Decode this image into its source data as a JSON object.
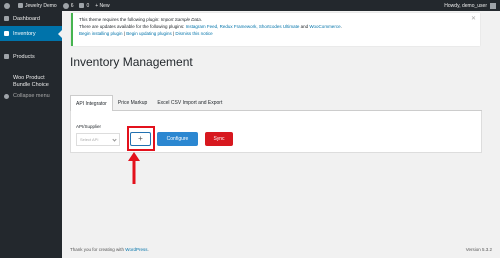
{
  "adminbar": {
    "site_name": "Jewelry Demo",
    "updates_count": "6",
    "comments_count": "0",
    "new_label": "+ New",
    "greeting": "Howdy, demo_user"
  },
  "sidebar": {
    "items": [
      {
        "label": "Dashboard"
      },
      {
        "label": "Inventory"
      },
      {
        "label": "Products"
      },
      {
        "label_line1": "Woo Product",
        "label_line2": "Bundle Choice"
      },
      {
        "label": "Collapse menu"
      }
    ]
  },
  "notice": {
    "line1_prefix": "This theme requires the following plugin: ",
    "line1_plugin": "Import Sample Data",
    "line1_suffix": ".",
    "line2_prefix": "There are updates available for the following plugins: ",
    "line2_plugins": "Instagram Feed, Redux Framework, Shortcodes Ultimate",
    "line2_and": " and ",
    "line2_last": "WooCommerce",
    "line2_suffix": ".",
    "action_begin_installing": "Begin installing plugin",
    "action_begin_updating": "Begin updating plugins",
    "action_dismiss": "Dismiss this notice",
    "separator": " | ",
    "dismiss_glyph": "✕"
  },
  "page": {
    "title": "Inventory Management"
  },
  "tabs": [
    {
      "label": "API Integrator"
    },
    {
      "label": "Price Markup"
    },
    {
      "label": "Excel CSV Import and Export"
    }
  ],
  "panel": {
    "field_label": "API/Supplier",
    "select_placeholder": "Select API",
    "add_label": "+",
    "configure_label": "Configure",
    "sync_label": "Sync"
  },
  "footer": {
    "thanks_prefix": "Thank you for creating with ",
    "thanks_link": "WordPress",
    "thanks_suffix": ".",
    "version": "Version 5.3.2"
  },
  "colors": {
    "adminbar_bg": "#23282d",
    "accent": "#0073aa",
    "notice_border": "#46b450",
    "configure_button": "#2b87d1",
    "sync_button": "#d7181f",
    "highlight": "#e3111c"
  },
  "icons": {
    "wp_logo": "wordpress-icon",
    "updates": "refresh-icon",
    "comments": "comment-icon",
    "dashboard": "dashboard-icon",
    "inventory": "inventory-icon",
    "products": "products-icon",
    "collapse": "collapse-icon",
    "annotation": "red-up-arrow"
  }
}
